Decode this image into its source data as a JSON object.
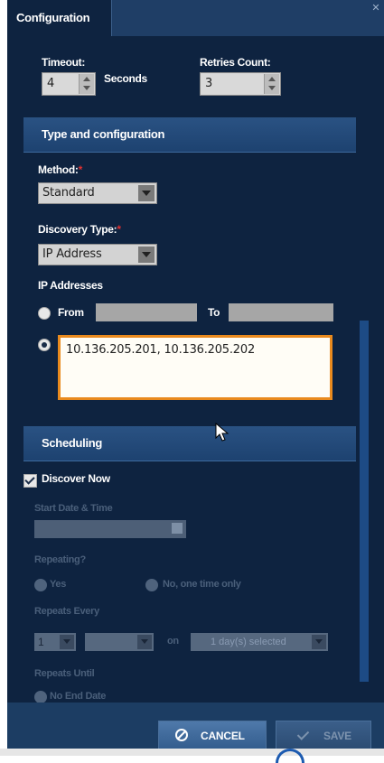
{
  "tab": {
    "label": "Configuration"
  },
  "timeout": {
    "label": "Timeout:",
    "value": "4",
    "unit": "Seconds"
  },
  "retries": {
    "label": "Retries Count:",
    "value": "3"
  },
  "type_section": {
    "title": "Type and configuration"
  },
  "method": {
    "label": "Method:",
    "required": "*",
    "value": "Standard"
  },
  "discovery_type": {
    "label": "Discovery Type:",
    "required": "*",
    "value": "IP Address"
  },
  "ip_addresses": {
    "label": "IP Addresses",
    "from_label": "From",
    "to_label": "To",
    "from_value": "",
    "to_value": "",
    "list_value": "10.136.205.201, 10.136.205.202"
  },
  "scheduling": {
    "title": "Scheduling",
    "discover_now": "Discover Now",
    "start_label": "Start Date & Time",
    "repeating_label": "Repeating?",
    "yes_label": "Yes",
    "no_label": "No, one time only",
    "repeats_every_label": "Repeats Every",
    "repeats_every_value": "1",
    "on_label": "on",
    "days_selected": "1 day(s) selected",
    "repeats_until_label": "Repeats Until",
    "no_end_date": "No End Date"
  },
  "footer": {
    "cancel": "CANCEL",
    "save": "SAVE"
  },
  "colors": {
    "panel": "#0e2340",
    "section": "#2a5283",
    "accent": "#e98a1e",
    "required": "#e03030"
  }
}
